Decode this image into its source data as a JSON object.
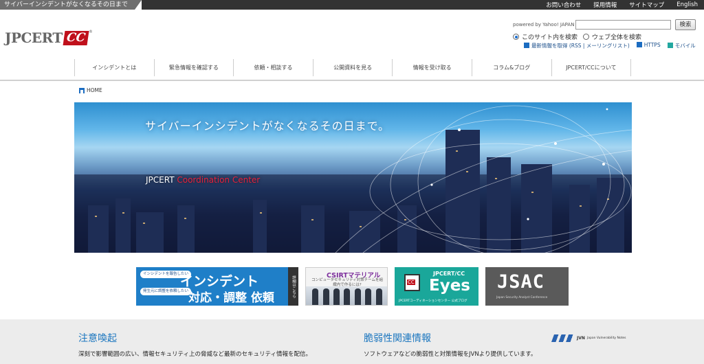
{
  "topbar": {
    "tagline": "サイバーインシデントがなくなるその日まで",
    "links": [
      "お問い合わせ",
      "採用情報",
      "サイトマップ",
      "English"
    ]
  },
  "logo": {
    "text": "JPCERT",
    "cc": "CC",
    "reg": "®"
  },
  "search": {
    "powered": "powered by Yahoo! JAPAN",
    "button": "検索",
    "scope_site": "このサイト内を検索",
    "scope_web": "ウェブ全体を検索",
    "rss": "最新情報を取得 (RSS | メーリングリスト)",
    "https": "HTTPS",
    "mobile": "モバイル"
  },
  "nav": [
    "インシデントとは",
    "緊急情報を確認する",
    "依頼・相談する",
    "公開資料を見る",
    "情報を受け取る",
    "コラム&ブログ",
    "JPCERT/CCについて"
  ],
  "breadcrumb": "HOME",
  "hero": {
    "tagline": "サイバーインシデントがなくなるその日まで。",
    "org1": "JPCERT",
    "org2": "Coordination Center"
  },
  "banners": {
    "incident": {
      "bubble1": "インシデントを報告したい",
      "bubble2": "発生元に調整を依頼したい",
      "line1": "インシデント",
      "line2": "対応・調整 依頼",
      "side": "詳細はこちら"
    },
    "csirt": {
      "title": "CSIRTマテリアル",
      "sub": "コンピュータセキュリティ対策チームを組織内で作るには?"
    },
    "eyes": {
      "top": "JPCERT/CC",
      "main": "Eyes",
      "sub": "JPCERTコーディネーションセンター 公式ブログ"
    },
    "jsac": {
      "main": "JSAC",
      "sub": "Japan Security Analyst Conference"
    }
  },
  "bottom": {
    "alert_title": "注意喚起",
    "alert_text": "深刻で影響範囲の広い、情報セキュリティ上の脅威など最新のセキュリティ情報を配信。",
    "vuln_title": "脆弱性関連情報",
    "vuln_text": "ソフトウェアなどの脆弱性と対策情報をJVNより提供しています。",
    "jvn": "JVN",
    "jvn_sub": "Japan Vulnerability Notes"
  },
  "colors": {
    "brand_red": "#c0101b",
    "link_blue": "#1b76bf"
  }
}
